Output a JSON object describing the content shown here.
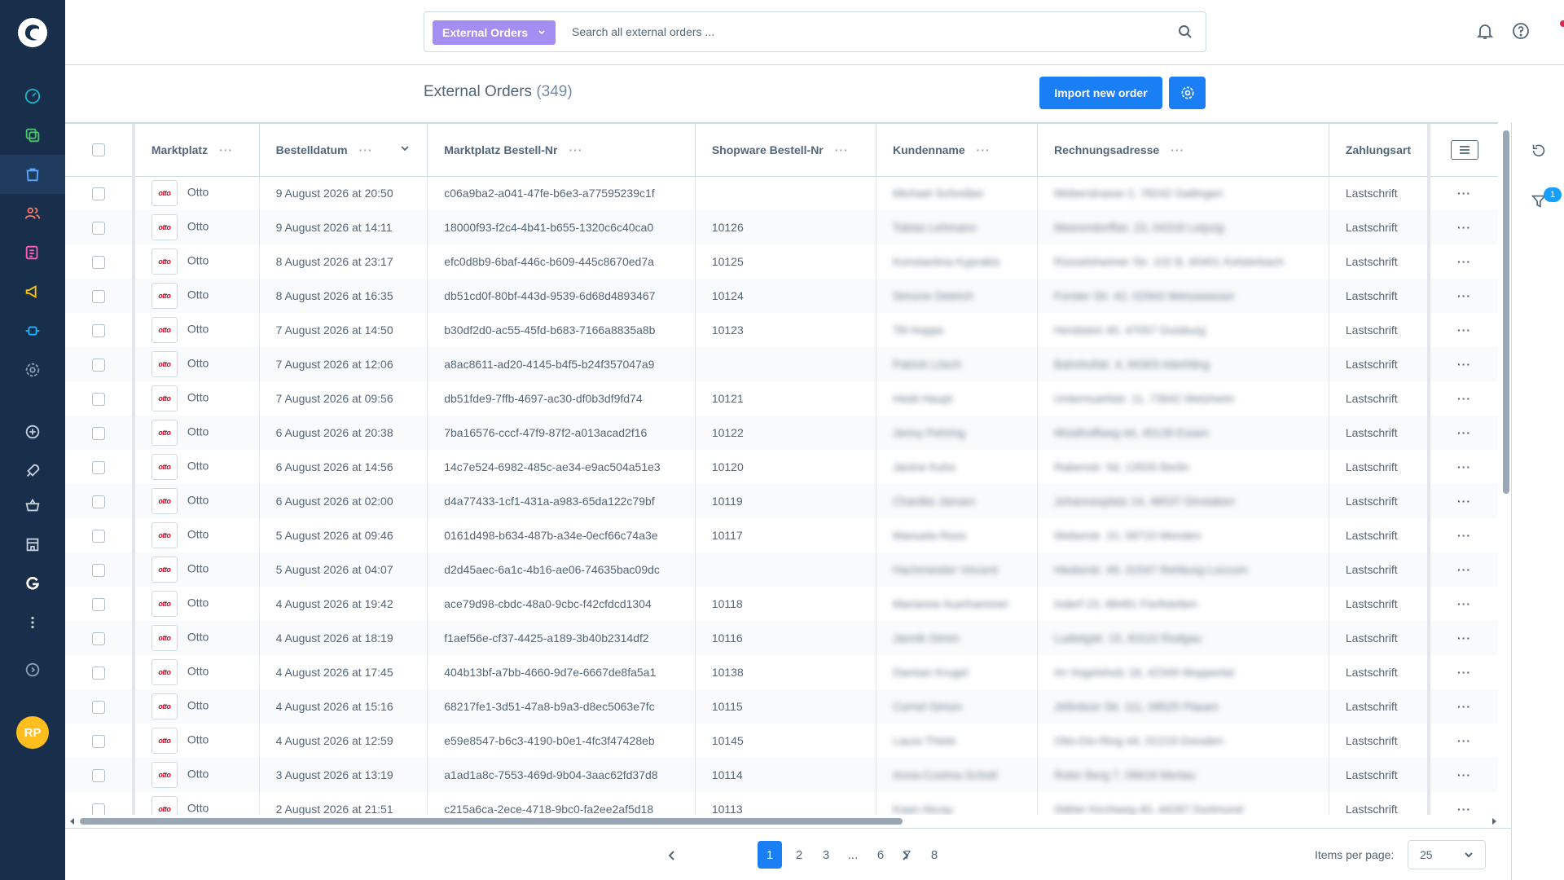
{
  "search": {
    "type_label": "External Orders",
    "placeholder": "Search all external orders ..."
  },
  "header": {
    "title": "External Orders",
    "count": "(349)",
    "import_label": "Import new order"
  },
  "user": {
    "initials": "RP"
  },
  "filter_badge": "1",
  "columns": [
    "Marktplatz",
    "Bestelldatum",
    "Marktplatz Bestell-Nr",
    "Shopware Bestell-Nr",
    "Kundenname",
    "Rechnungsadresse",
    "Zahlungsart"
  ],
  "rows": [
    {
      "marketplace": "Otto",
      "date": "9 August 2026 at 20:50",
      "mp_no": "c06a9ba2-a041-47fe-b6e3-a77595239c1f",
      "sw_no": "",
      "customer": "Michael Schreiber",
      "address": "Weberstrasse 2, 78242 Gailingen",
      "payment": "Lastschrift"
    },
    {
      "marketplace": "Otto",
      "date": "9 August 2026 at 14:11",
      "mp_no": "18000f93-f2c4-4b41-b655-1320c6c40ca0",
      "sw_no": "10126",
      "customer": "Tobias Lehmann",
      "address": "Meerendorffstr. 23, 04318 Leipzig",
      "payment": "Lastschrift"
    },
    {
      "marketplace": "Otto",
      "date": "8 August 2026 at 23:17",
      "mp_no": "efc0d8b9-6baf-446c-b609-445c8670ed7a",
      "sw_no": "10125",
      "customer": "Konstantina Kyprakis",
      "address": "Rüsselsheimer Str. 102 B, 65451 Kelsterbach",
      "payment": "Lastschrift"
    },
    {
      "marketplace": "Otto",
      "date": "8 August 2026 at 16:35",
      "mp_no": "db51cd0f-80bf-443d-9539-6d68d4893467",
      "sw_no": "10124",
      "customer": "Simone Dietrich",
      "address": "Forster Str. 42, 02943 Weisswasser",
      "payment": "Lastschrift"
    },
    {
      "marketplace": "Otto",
      "date": "7 August 2026 at 14:50",
      "mp_no": "b30df2d0-ac55-45fd-b683-7166a8835a8b",
      "sw_no": "10123",
      "customer": "Till Hoppe",
      "address": "Herdstein 40, 47057 Duisburg",
      "payment": "Lastschrift"
    },
    {
      "marketplace": "Otto",
      "date": "7 August 2026 at 12:06",
      "mp_no": "a8ac8611-ad20-4145-b4f5-b24f357047a9",
      "sw_no": "",
      "customer": "Patrick Lösch",
      "address": "Bahnhofstr. 4, 84303 Aiterhling",
      "payment": "Lastschrift"
    },
    {
      "marketplace": "Otto",
      "date": "7 August 2026 at 09:56",
      "mp_no": "db51fde9-7ffb-4697-ac30-df0b3df9fd74",
      "sw_no": "10121",
      "customer": "Heidi Haupt",
      "address": "Untermuehlstr. 11, 73642 Welzheim",
      "payment": "Lastschrift"
    },
    {
      "marketplace": "Otto",
      "date": "6 August 2026 at 20:38",
      "mp_no": "7ba16576-cccf-47f9-87f2-a013acad2f16",
      "sw_no": "10122",
      "customer": "Jenny Fehring",
      "address": "Wüsthoffweg 44, 45139 Essen",
      "payment": "Lastschrift"
    },
    {
      "marketplace": "Otto",
      "date": "6 August 2026 at 14:56",
      "mp_no": "14c7e524-6982-485c-ae34-e9ac504a51e3",
      "sw_no": "10120",
      "customer": "Janine Kuhs",
      "address": "Rabenstr. 5d, 13505 Berlin",
      "payment": "Lastschrift"
    },
    {
      "marketplace": "Otto",
      "date": "6 August 2026 at 02:00",
      "mp_no": "d4a77433-1cf1-431a-a983-65da122c79bf",
      "sw_no": "10119",
      "customer": "Chantke Jansen",
      "address": "Johannesplatz 14, 46537 Dinslaken",
      "payment": "Lastschrift"
    },
    {
      "marketplace": "Otto",
      "date": "5 August 2026 at 09:46",
      "mp_no": "0161d498-b634-487b-a34e-0ecf66c74a3e",
      "sw_no": "10117",
      "customer": "Manuela Roos",
      "address": "Weberstr. 10, 58710 Menden",
      "payment": "Lastschrift"
    },
    {
      "marketplace": "Otto",
      "date": "5 August 2026 at 04:07",
      "mp_no": "d2d45aec-6a1c-4b16-ae06-74635bac09dc",
      "sw_no": "",
      "customer": "Hachmeister Vincent",
      "address": "Hiedorstr. 49, 31547 Rehburg-Loccum",
      "payment": "Lastschrift"
    },
    {
      "marketplace": "Otto",
      "date": "4 August 2026 at 19:42",
      "mp_no": "ace79d98-cbdc-48a0-9cbc-f42cfdcd1304",
      "sw_no": "10118",
      "customer": "Marianne Auerhammer",
      "address": "Inderf 23, 86481 Fünfstetten",
      "payment": "Lastschrift"
    },
    {
      "marketplace": "Otto",
      "date": "4 August 2026 at 18:19",
      "mp_no": "f1aef56e-cf37-4425-a189-3b40b2314df2",
      "sw_no": "10116",
      "customer": "Jannik Gimm",
      "address": "Ludwigstr. 15, 63110 Rodgau",
      "payment": "Lastschrift"
    },
    {
      "marketplace": "Otto",
      "date": "4 August 2026 at 17:45",
      "mp_no": "404b13bf-a7bb-4660-9d7e-6667de8fa5a1",
      "sw_no": "10138",
      "customer": "Damian Krugel",
      "address": "Im Vogelsholz 18, 42349 Wuppertal",
      "payment": "Lastschrift"
    },
    {
      "marketplace": "Otto",
      "date": "4 August 2026 at 15:16",
      "mp_no": "68217fe1-3d51-47a8-b9a3-d8ec5063e7fc",
      "sw_no": "10115",
      "customer": "Cornel Simon",
      "address": "Jößnitzer Str. 111, 08525 Plauen",
      "payment": "Lastschrift"
    },
    {
      "marketplace": "Otto",
      "date": "4 August 2026 at 12:59",
      "mp_no": "e59e8547-b6c3-4190-b0e1-4fc3f47428eb",
      "sw_no": "10145",
      "customer": "Laura Thiele",
      "address": "Otto-Dix-Ring 44, 01219 Dresden",
      "payment": "Lastschrift"
    },
    {
      "marketplace": "Otto",
      "date": "3 August 2026 at 13:19",
      "mp_no": "a1ad1a8c-7553-469d-9b04-3aac62fd37d8",
      "sw_no": "10114",
      "customer": "Anna-Cosima Schott",
      "address": "Roter Berg 7, 06618 Mertau",
      "payment": "Lastschrift"
    },
    {
      "marketplace": "Otto",
      "date": "2 August 2026 at 21:51",
      "mp_no": "c215a6ca-2ece-4718-9bc0-fa2ee2af5d18",
      "sw_no": "10113",
      "customer": "Kaan Akcay",
      "address": "Stikler Kirchweg 40, 44287 Dortmund",
      "payment": "Lastschrift"
    }
  ],
  "pagination": {
    "pages": [
      "1",
      "2",
      "3",
      "...",
      "6",
      "7",
      "8"
    ],
    "current": "1",
    "items_per_page_label": "Items per page:",
    "items_per_page": "25"
  },
  "colors": {
    "sidebar": "#182f4b",
    "accent": "#1a7ef5",
    "type_pill": "#a48ef2",
    "otto_red": "#e3001b",
    "avatar": "#ffbd1e"
  },
  "icons": {
    "sidebar": [
      "dashboard-icon",
      "catalogue-icon",
      "orders-icon",
      "customers-icon",
      "content-icon",
      "marketing-icon",
      "extensions-icon",
      "settings-icon",
      "add-icon",
      "rocket-icon",
      "basket-icon",
      "storefront-icon",
      "google-icon",
      "more-icon",
      "expand-icon"
    ]
  }
}
